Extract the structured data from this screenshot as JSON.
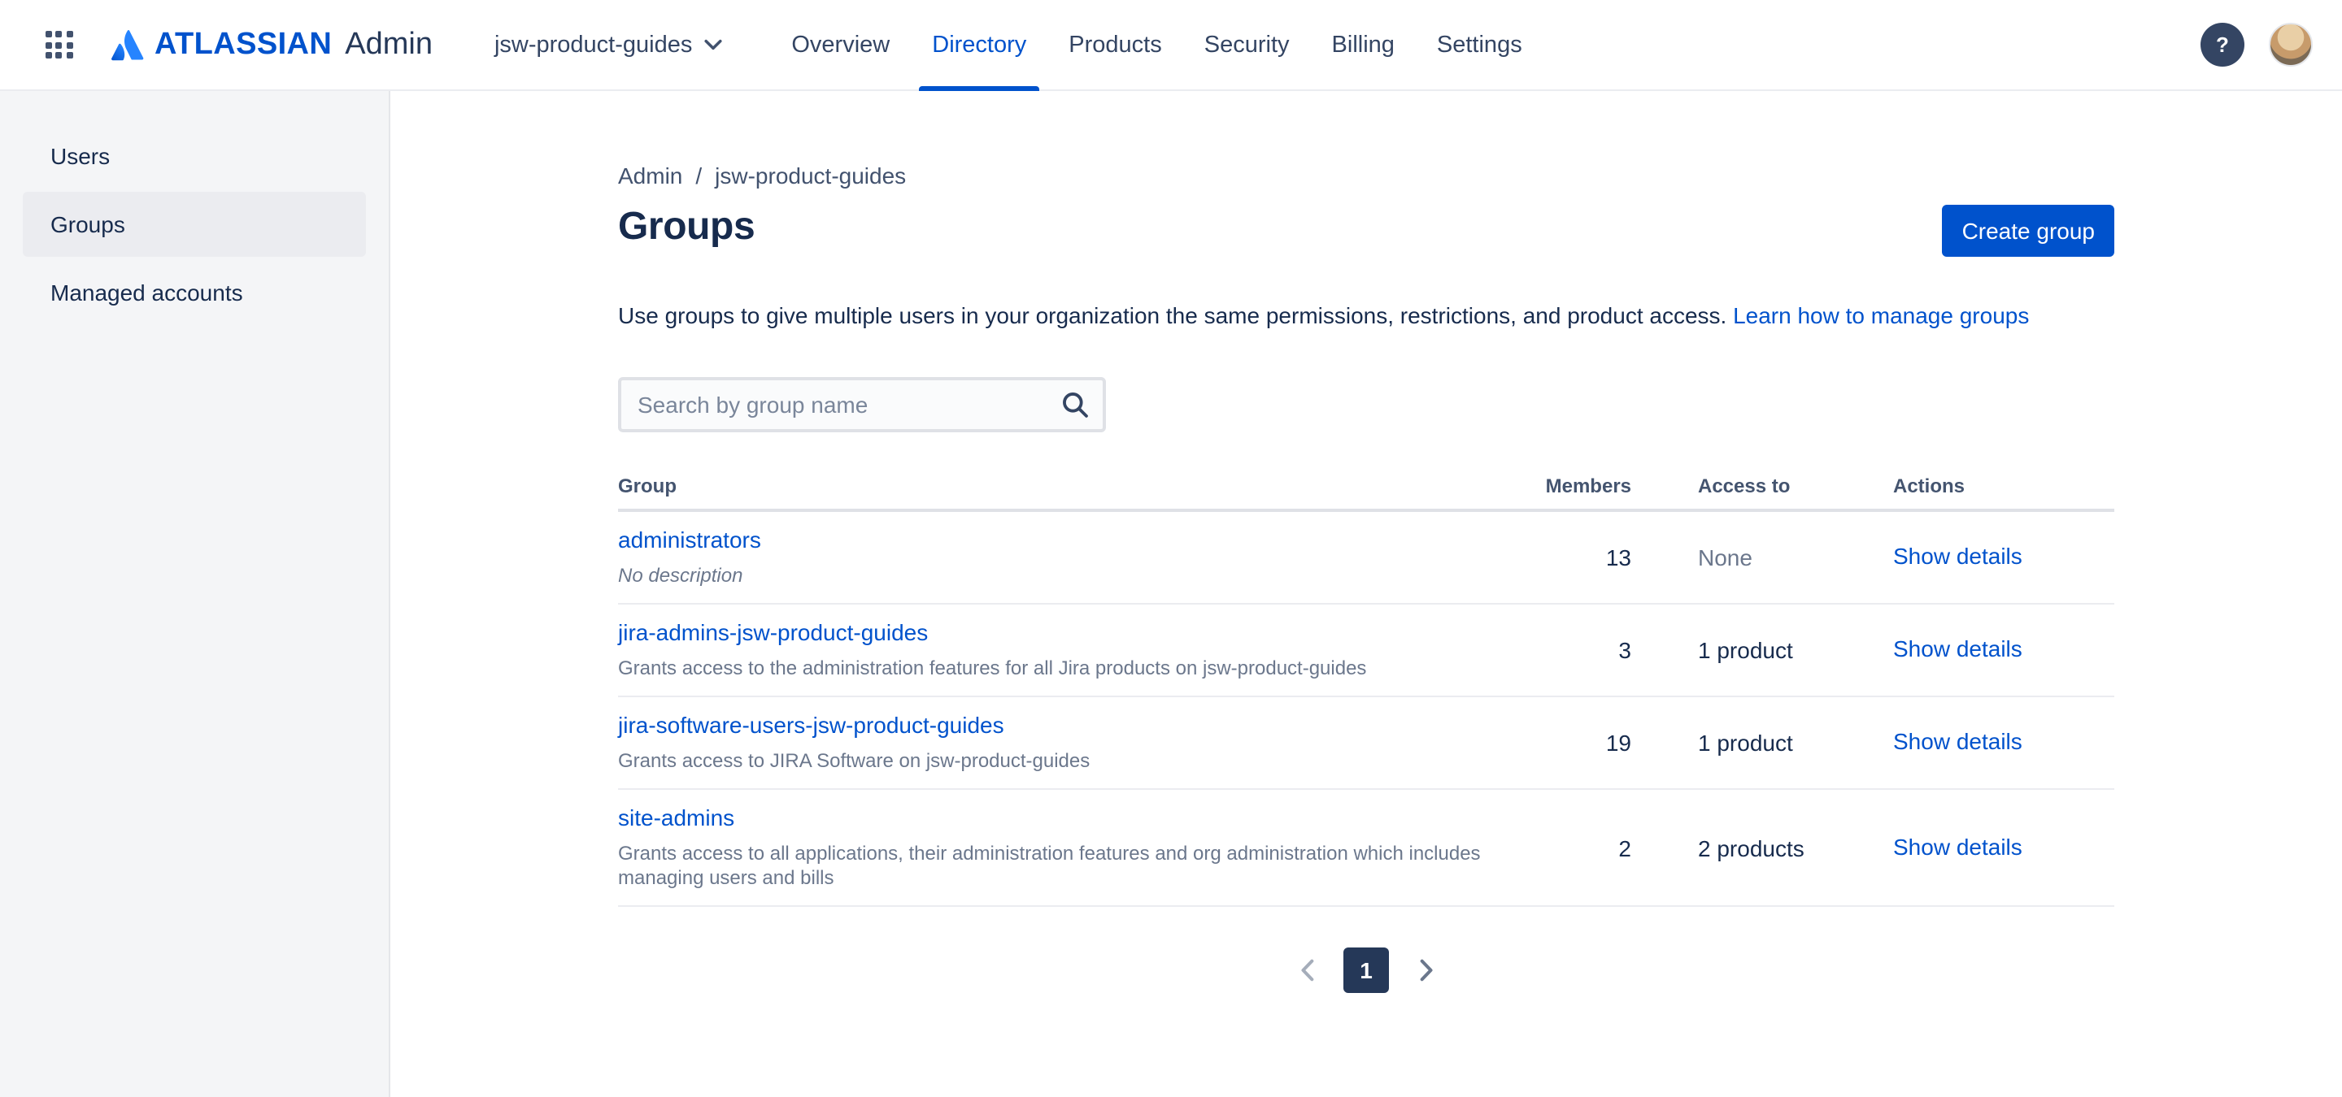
{
  "navbar": {
    "logo_text": "ATLASSIAN",
    "app_name": "Admin",
    "org_selector": "jsw-product-guides",
    "tabs": [
      {
        "label": "Overview",
        "active": false
      },
      {
        "label": "Directory",
        "active": true
      },
      {
        "label": "Products",
        "active": false
      },
      {
        "label": "Security",
        "active": false
      },
      {
        "label": "Billing",
        "active": false
      },
      {
        "label": "Settings",
        "active": false
      }
    ],
    "help_glyph": "?"
  },
  "sidebar": {
    "items": [
      {
        "label": "Users",
        "selected": false
      },
      {
        "label": "Groups",
        "selected": true
      },
      {
        "label": "Managed accounts",
        "selected": false
      }
    ]
  },
  "main": {
    "breadcrumb": {
      "home": "Admin",
      "separator": "/",
      "current": "jsw-product-guides"
    },
    "title": "Groups",
    "create_button": "Create group",
    "description": "Use groups to give multiple users in your organization the same permissions, restrictions, and product access.",
    "learn_link": "Learn how to manage groups",
    "search_placeholder": "Search by group name",
    "table": {
      "headers": [
        "Group",
        "Members",
        "Access to",
        "Actions"
      ],
      "rows": [
        {
          "name": "administrators",
          "description": "No description",
          "description_italic": true,
          "members": "13",
          "access": "None",
          "access_muted": true,
          "action": "Show details"
        },
        {
          "name": "jira-admins-jsw-product-guides",
          "description": "Grants access to the administration features for all Jira products on jsw-product-guides",
          "description_italic": false,
          "members": "3",
          "access": "1 product",
          "access_muted": false,
          "action": "Show details"
        },
        {
          "name": "jira-software-users-jsw-product-guides",
          "description": "Grants access to JIRA Software on jsw-product-guides",
          "description_italic": false,
          "members": "19",
          "access": "1 product",
          "access_muted": false,
          "action": "Show details"
        },
        {
          "name": "site-admins",
          "description": "Grants access to all applications, their administration features and org administration which includes managing users and bills",
          "description_italic": false,
          "members": "2",
          "access": "2 products",
          "access_muted": false,
          "action": "Show details"
        }
      ]
    },
    "pagination": {
      "current": "1"
    }
  },
  "colors": {
    "accent": "#0052CC",
    "text": "#172B4D",
    "muted_text": "#6B778C",
    "sidebar_bg": "#F4F5F7",
    "sidebar_selected_bg": "#EBECF0",
    "pagination_selected_bg": "#253858"
  }
}
